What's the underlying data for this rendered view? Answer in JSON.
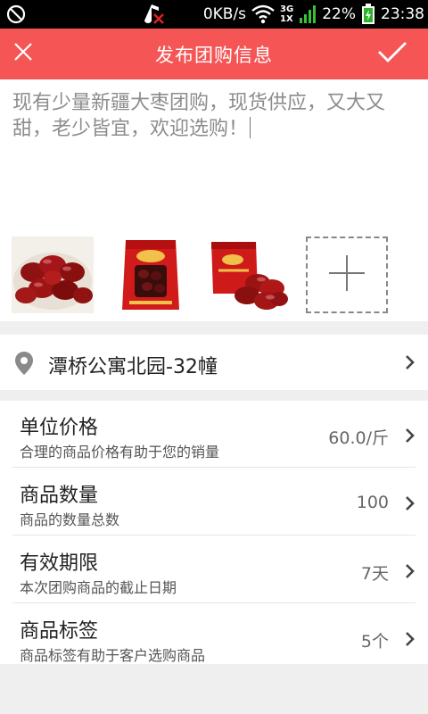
{
  "status_bar": {
    "speed": "0KB/s",
    "network_top": "3G",
    "network_bottom": "1X",
    "battery": "22%",
    "time": "23:38"
  },
  "header": {
    "title": "发布团购信息"
  },
  "composer": {
    "text": "现有少量新疆大枣团购，现货供应，又大又甜，老少皆宜，欢迎选购！",
    "photos": [
      "red-dates-bowl",
      "red-dates-package",
      "red-dates-bag"
    ]
  },
  "location": {
    "address": "潭桥公寓北园-32幢"
  },
  "list": {
    "rows": [
      {
        "title": "单位价格",
        "subtitle": "合理的商品价格有助于您的销量",
        "value": "60.0/斤"
      },
      {
        "title": "商品数量",
        "subtitle": "商品的数量总数",
        "value": "100"
      },
      {
        "title": "有效期限",
        "subtitle": "本次团购商品的截止日期",
        "value": "7天"
      },
      {
        "title": "商品标签",
        "subtitle": "商品标签有助于客户选购商品",
        "value": "5个"
      }
    ]
  },
  "colors": {
    "accent": "#f55555",
    "background": "#efefef"
  }
}
